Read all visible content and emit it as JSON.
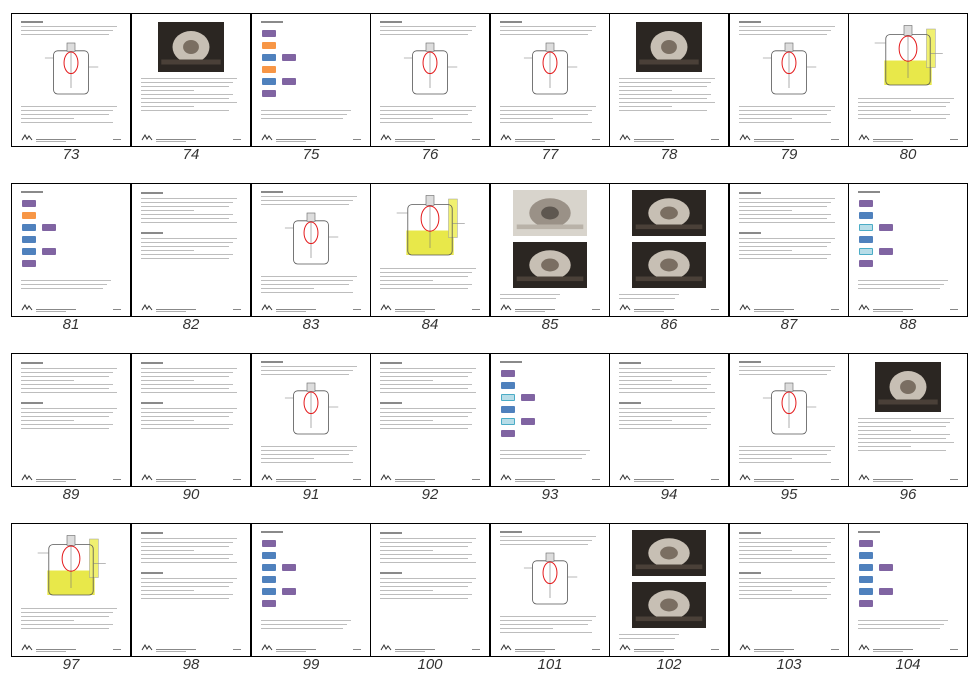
{
  "grid": {
    "pages": [
      {
        "num": "73",
        "kind": "diagram"
      },
      {
        "num": "74",
        "kind": "photo"
      },
      {
        "num": "75",
        "kind": "flow"
      },
      {
        "num": "76",
        "kind": "diagram"
      },
      {
        "num": "77",
        "kind": "diagram"
      },
      {
        "num": "78",
        "kind": "photo"
      },
      {
        "num": "79",
        "kind": "diagram"
      },
      {
        "num": "80",
        "kind": "yellow"
      },
      {
        "num": "81",
        "kind": "flow"
      },
      {
        "num": "82",
        "kind": "text"
      },
      {
        "num": "83",
        "kind": "diagram"
      },
      {
        "num": "84",
        "kind": "yellow"
      },
      {
        "num": "85",
        "kind": "photo2"
      },
      {
        "num": "86",
        "kind": "photo2"
      },
      {
        "num": "87",
        "kind": "text"
      },
      {
        "num": "88",
        "kind": "flow"
      },
      {
        "num": "89",
        "kind": "text"
      },
      {
        "num": "90",
        "kind": "text"
      },
      {
        "num": "91",
        "kind": "diagram"
      },
      {
        "num": "92",
        "kind": "text"
      },
      {
        "num": "93",
        "kind": "flow"
      },
      {
        "num": "94",
        "kind": "text"
      },
      {
        "num": "95",
        "kind": "diagram"
      },
      {
        "num": "96",
        "kind": "photo"
      },
      {
        "num": "97",
        "kind": "yellow"
      },
      {
        "num": "98",
        "kind": "text"
      },
      {
        "num": "99",
        "kind": "flow"
      },
      {
        "num": "100",
        "kind": "text"
      },
      {
        "num": "101",
        "kind": "diagram"
      },
      {
        "num": "102",
        "kind": "photo2"
      },
      {
        "num": "103",
        "kind": "text"
      },
      {
        "num": "104",
        "kind": "flow"
      }
    ]
  },
  "colors": {
    "purple": "#8064a2",
    "blue": "#4f81bd",
    "orange": "#f79646",
    "teal": "#b7dde8",
    "highlight_ring": "#e41a1c",
    "liquid_yellow": "#e8e84a"
  }
}
